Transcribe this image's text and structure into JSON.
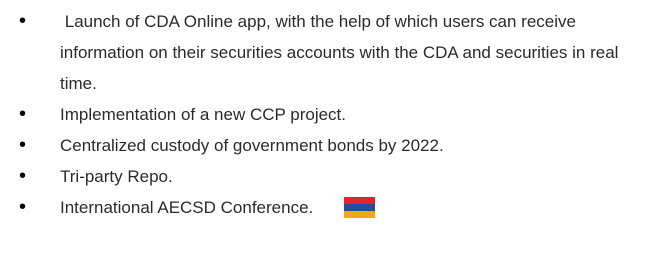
{
  "items": [
    {
      "text": " Launch of CDA Online app, with the help of which users can receive information on their securities accounts with the CDA and securities in real time."
    },
    {
      "text": "Implementation of a new CCP project."
    },
    {
      "text": "Centralized custody of government bonds by 2022."
    },
    {
      "text": "Tri-party Repo."
    },
    {
      "text": "International AECSD Conference."
    }
  ],
  "bullet_glyph": "•",
  "flag": {
    "icon": "armenia-flag-icon",
    "colors": [
      "#e0262e",
      "#1f4fa0",
      "#f2a80e"
    ]
  }
}
